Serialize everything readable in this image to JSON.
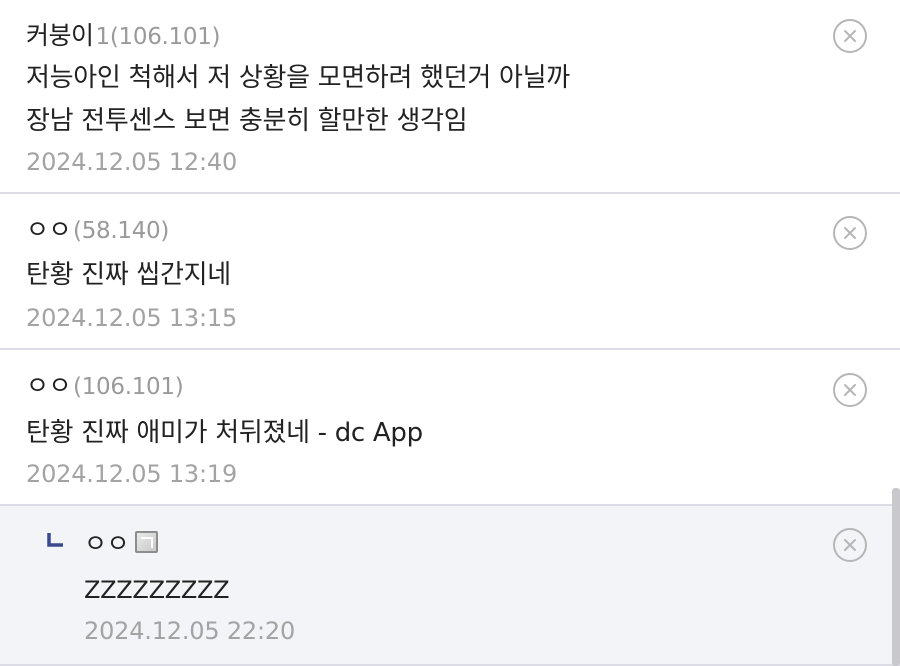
{
  "comments": [
    {
      "nickname": "커붕이",
      "ip": "1(106.101)",
      "lines": [
        "저능아인 척해서 저 상황을 모면하려 했던거 아닐까",
        "장남 전투센스 보면 충분히 할만한 생각임"
      ],
      "date": "2024.12.05 12:40"
    },
    {
      "nickname": "ㅇㅇ",
      "ip": "(58.140)",
      "lines": [
        "탄황 진짜 씹간지네"
      ],
      "date": "2024.12.05 13:15"
    },
    {
      "nickname": "ㅇㅇ",
      "ip": "(106.101)",
      "lines": [
        "탄황 진짜 애미가 처뒤졌네 - dc App"
      ],
      "date": "2024.12.05 13:19"
    },
    {
      "nickname": "ㅇㅇ",
      "reply": true,
      "lines": [
        "ZZZZZZZZZ"
      ],
      "date": "2024.12.05 22:20"
    }
  ],
  "icons": {
    "delete": "close-circle-icon",
    "reply": "reply-arrow-icon",
    "app": "mobile-app-icon"
  },
  "colors": {
    "divider": "#dcdce6",
    "reply_bg": "#f3f4f8",
    "reply_arrow": "#3b4a8c",
    "meta_text": "#a3a3a3"
  }
}
